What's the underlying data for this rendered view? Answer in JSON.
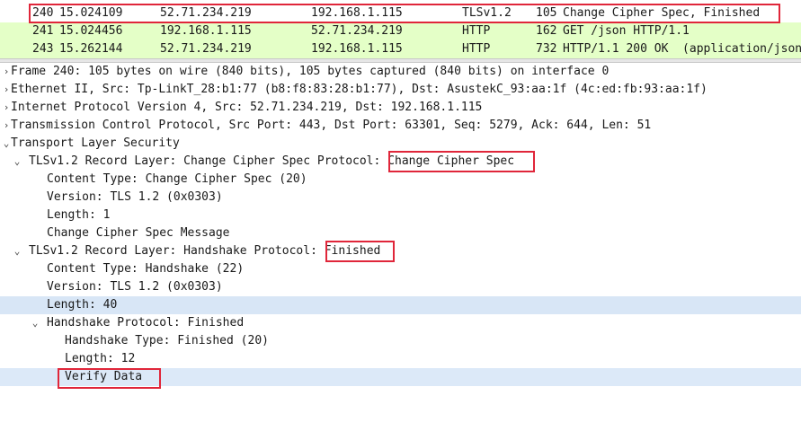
{
  "packet_list": [
    {
      "no": "240",
      "time": "15.024109",
      "src": "52.71.234.219",
      "dst": "192.168.1.115",
      "proto": "TLSv1.2",
      "len": "105",
      "info": "Change Cipher Spec, Finished"
    },
    {
      "no": "241",
      "time": "15.024456",
      "src": "192.168.1.115",
      "dst": "52.71.234.219",
      "proto": "HTTP",
      "len": "162",
      "info": "GET /json HTTP/1.1"
    },
    {
      "no": "243",
      "time": "15.262144",
      "src": "52.71.234.219",
      "dst": "192.168.1.115",
      "proto": "HTTP",
      "len": "732",
      "info": "HTTP/1.1 200 OK  (application/json)"
    }
  ],
  "details": {
    "frame": "Frame 240: 105 bytes on wire (840 bits), 105 bytes captured (840 bits) on interface 0",
    "ethernet": "Ethernet II, Src: Tp-LinkT_28:b1:77 (b8:f8:83:28:b1:77), Dst: AsustekC_93:aa:1f (4c:ed:fb:93:aa:1f)",
    "ip": "Internet Protocol Version 4, Src: 52.71.234.219, Dst: 192.168.1.115",
    "tcp": "Transmission Control Protocol, Src Port: 443, Dst Port: 63301, Seq: 5279, Ack: 644, Len: 51",
    "tls": "Transport Layer Security",
    "rec1_prefix": "TLSv1.2 Record Layer: Change Cipher Spec Protocol: ",
    "rec1_value": "Change Cipher Spec",
    "rec1_content_type": "Content Type: Change Cipher Spec (20)",
    "rec1_version": "Version: TLS 1.2 (0x0303)",
    "rec1_length": "Length: 1",
    "rec1_message": "Change Cipher Spec Message",
    "rec2_prefix": "TLSv1.2 Record Layer: Handshake Protocol: ",
    "rec2_value": "Finished",
    "rec2_content_type": "Content Type: Handshake (22)",
    "rec2_version": "Version: TLS 1.2 (0x0303)",
    "rec2_length": "Length: 40",
    "hs": "Handshake Protocol: Finished",
    "hs_type": "Handshake Type: Finished (20)",
    "hs_length": "Length: 12",
    "verify": "Verify Data"
  },
  "icons": {
    "expanded": "chevron-down-icon",
    "collapsed": "chevron-right-icon"
  },
  "colors": {
    "highlight_box": "#e0263a",
    "http_row": "#e4ffc7",
    "selected_field": "#dce9f8"
  }
}
